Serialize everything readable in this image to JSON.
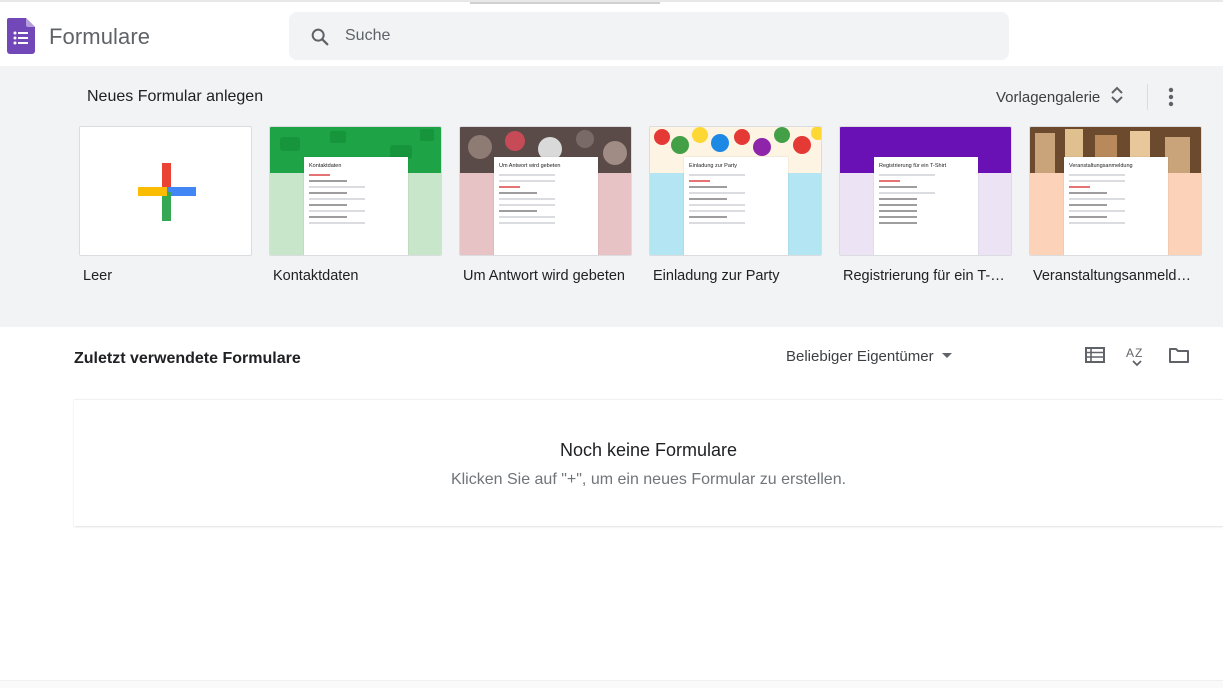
{
  "app": {
    "title": "Formulare",
    "accent_color": "#673ab7"
  },
  "search": {
    "placeholder": "Suche",
    "icon": "search-icon"
  },
  "templates": {
    "heading": "Neues Formular anlegen",
    "gallery_label": "Vorlagengalerie",
    "more_icon": "more-vert-icon",
    "items": [
      {
        "label": "Leer"
      },
      {
        "label": "Kontaktdaten",
        "sheet_title": "Kontaktdaten",
        "band_color": "#1ea446",
        "lower_color": "#c8e6c9"
      },
      {
        "label": "Um Antwort wird gebeten",
        "sheet_title": "Um Antwort wird gebeten",
        "band_color": "#5a4b48",
        "lower_color": "#e8c3c5"
      },
      {
        "label": "Einladung zur Party",
        "sheet_title": "Einladung zur Party",
        "band_color": "#f4c542",
        "lower_color": "#b3e5f3"
      },
      {
        "label": "Registrierung für ein T-Shirt",
        "sheet_title": "Registrierung für ein T-Shirt",
        "band_color": "#6a11b5",
        "lower_color": "#ece4f4"
      },
      {
        "label": "Veranstaltungsanmeldung",
        "sheet_title": "Veranstaltungsanmeldung",
        "band_color": "#6b4a2e",
        "lower_color": "#fcd2b8"
      }
    ]
  },
  "recent": {
    "heading": "Zuletzt verwendete Formulare",
    "owner_filter": "Beliebiger Eigentümer",
    "empty_title": "Noch keine Formulare",
    "empty_subtitle": "Klicken Sie auf \"+\", um ein neues Formular zu erstellen."
  }
}
